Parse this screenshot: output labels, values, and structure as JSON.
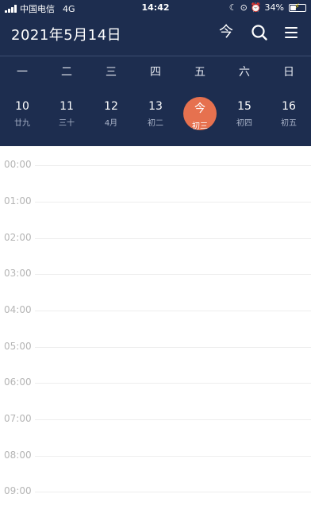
{
  "status_bar": {
    "carrier": "中国电信",
    "network": "4G",
    "time": "14:42",
    "battery_percent": "34%"
  },
  "header": {
    "title": "2021年5月14日",
    "today_button": "今"
  },
  "weekdays": [
    "一",
    "二",
    "三",
    "四",
    "五",
    "六",
    "日"
  ],
  "days": [
    {
      "num": "10",
      "lunar": "廿九"
    },
    {
      "num": "11",
      "lunar": "三十"
    },
    {
      "num": "12",
      "lunar": "4月"
    },
    {
      "num": "13",
      "lunar": "初二"
    },
    {
      "num": "今",
      "lunar": "初三"
    },
    {
      "num": "15",
      "lunar": "初四"
    },
    {
      "num": "16",
      "lunar": "初五"
    }
  ],
  "hours": [
    "00:00",
    "01:00",
    "02:00",
    "03:00",
    "04:00",
    "05:00",
    "06:00",
    "07:00",
    "08:00",
    "09:00"
  ],
  "colors": {
    "header_bg": "#1d2d4f",
    "today_accent": "#e6714f"
  }
}
